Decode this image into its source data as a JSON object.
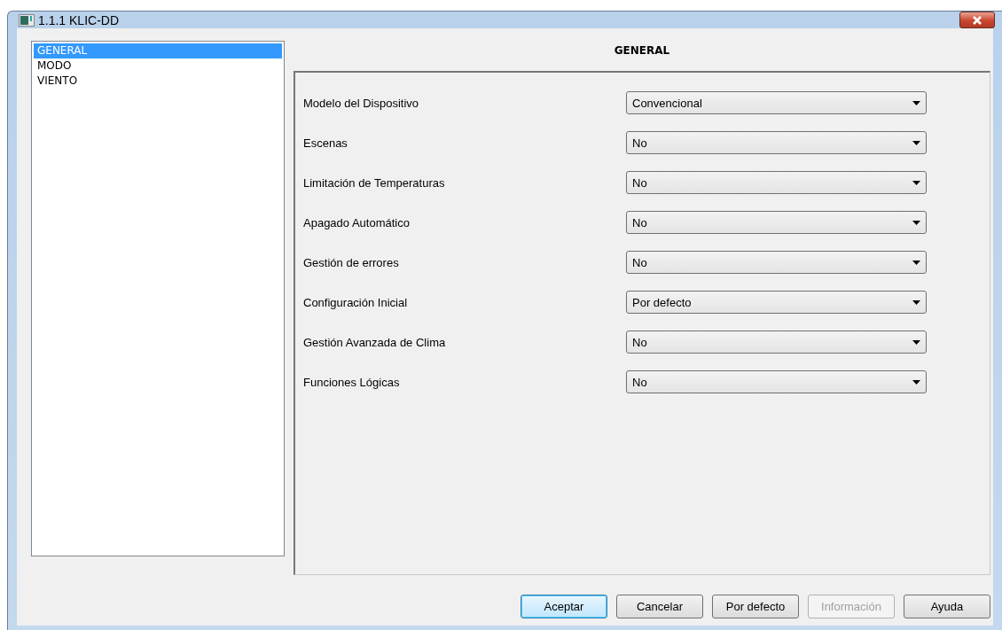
{
  "window": {
    "title": "1.1.1 KLIC-DD"
  },
  "sidebar": {
    "items": [
      {
        "label": "GENERAL",
        "selected": true
      },
      {
        "label": "MODO",
        "selected": false
      },
      {
        "label": "VIENTO",
        "selected": false
      }
    ]
  },
  "panel": {
    "title": "GENERAL",
    "fields": [
      {
        "label": "Modelo del Dispositivo",
        "value": "Convencional"
      },
      {
        "label": "Escenas",
        "value": "No"
      },
      {
        "label": "Limitación de Temperaturas",
        "value": "No"
      },
      {
        "label": "Apagado Automático",
        "value": "No"
      },
      {
        "label": "Gestión de errores",
        "value": "No"
      },
      {
        "label": "Configuración Inicial",
        "value": "Por defecto"
      },
      {
        "label": "Gestión Avanzada de Clima",
        "value": "No"
      },
      {
        "label": "Funciones Lógicas",
        "value": "No"
      }
    ]
  },
  "buttons": [
    {
      "label": "Aceptar",
      "focused": true,
      "disabled": false
    },
    {
      "label": "Cancelar",
      "focused": false,
      "disabled": false
    },
    {
      "label": "Por defecto",
      "focused": false,
      "disabled": false
    },
    {
      "label": "Información",
      "focused": false,
      "disabled": true
    },
    {
      "label": "Ayuda",
      "focused": false,
      "disabled": false
    }
  ]
}
